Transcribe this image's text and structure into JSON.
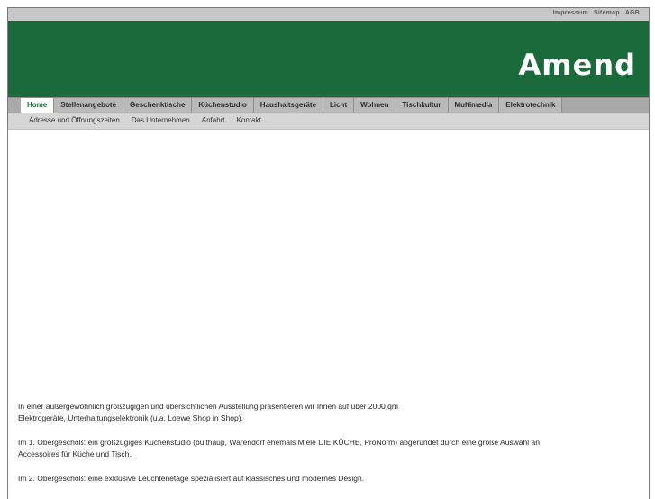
{
  "toplinks": {
    "impressum": "Impressum",
    "sitemap": "Sitemap",
    "agb": "AGB"
  },
  "logo": "Amend",
  "nav": [
    {
      "label": "Home"
    },
    {
      "label": "Stellenangebote"
    },
    {
      "label": "Geschenktische"
    },
    {
      "label": "Küchenstudio"
    },
    {
      "label": "Haushaltsgeräte"
    },
    {
      "label": "Licht"
    },
    {
      "label": "Wohnen"
    },
    {
      "label": "Tischkultur"
    },
    {
      "label": "Multimedia"
    },
    {
      "label": "Elektrotechnik"
    }
  ],
  "subnav": [
    {
      "label": "Adresse und Öffnungszeiten"
    },
    {
      "label": "Das Unternehmen"
    },
    {
      "label": "Anfahrt"
    },
    {
      "label": "Kontakt"
    }
  ],
  "content": {
    "p1_line1": "In einer außergewöhnlich großzügigen und übersichtlichen Ausstellung präsentieren wir Ihnen auf über 2000 qm",
    "p1_line2": "Elektrogeräte, Unterhaltungselektronik (u.a. Loewe Shop in Shop).",
    "p2_line1": "Im 1. Obergeschoß: ein großzügiges Küchenstudio (bulthaup, Warendorf ehemals Miele DIE KÜCHE, ProNorm) abgerundet durch eine große Auswahl an",
    "p2_line2": "Accessoires für Küche und Tisch.",
    "p3_line1": "Im 2. Obergeschoß: eine exklusive Leuchtenetage spezialisiert auf klassisches und modernes Design."
  },
  "colors": {
    "brand_green": "#1b6a3b",
    "nav_gray": "#a9a9a9"
  }
}
